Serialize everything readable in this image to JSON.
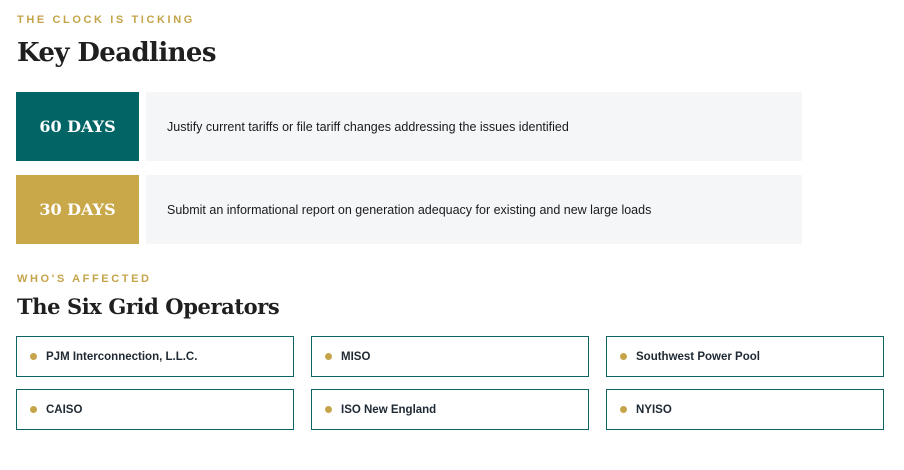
{
  "colors": {
    "accent_gold": "#c5a44a",
    "accent_teal": "#0d6463",
    "panel_bg": "#f5f6f8"
  },
  "deadlines_section": {
    "eyebrow": "THE CLOCK IS TICKING",
    "title": "Key Deadlines",
    "items": [
      {
        "badge": "60 DAYS",
        "badge_color": "#006564",
        "text": "Justify current tariffs or file tariff changes addressing the issues identified"
      },
      {
        "badge": "30 DAYS",
        "badge_color": "#c9a84a",
        "text": "Submit an informational report on generation adequacy for existing and new large loads"
      }
    ]
  },
  "operators_section": {
    "eyebrow": "WHO'S AFFECTED",
    "title": "The Six Grid Operators",
    "bullet_icon": "dot-bullet-icon",
    "bullet_color": "#c5a44a",
    "operators": [
      "PJM Interconnection, L.L.C.",
      "MISO",
      "Southwest Power Pool",
      "CAISO",
      "ISO New England",
      "NYISO"
    ]
  }
}
